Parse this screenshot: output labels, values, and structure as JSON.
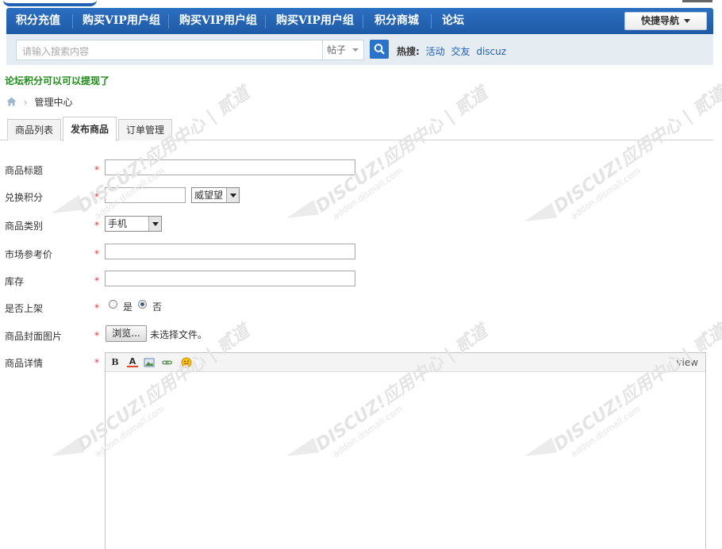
{
  "nav": {
    "items": [
      "积分充值",
      "购买VIP用户组",
      "购买VIP用户组",
      "购买VIP用户组",
      "积分商城",
      "论坛"
    ],
    "quick_nav_label": "快捷导航"
  },
  "search": {
    "placeholder": "请输入搜索内容",
    "type_label": "帖子",
    "hot_label": "热搜:",
    "hot_keywords": [
      "活动",
      "交友",
      "discuz"
    ]
  },
  "notice": "论坛积分可以可以提现了",
  "breadcrumb": {
    "current": "管理中心"
  },
  "tabs": [
    "商品列表",
    "发布商品",
    "订单管理"
  ],
  "form": {
    "title_label": "商品标题",
    "points_label": "兑换积分",
    "points_unit": "威望望",
    "category_label": "商品类别",
    "category_value": "手机",
    "market_price_label": "市场参考价",
    "stock_label": "库存",
    "on_shelf_label": "是否上架",
    "on_shelf_yes": "是",
    "on_shelf_no": "否",
    "cover_label": "商品封面图片",
    "browse_label": "浏览...",
    "no_file_label": "未选择文件。",
    "details_label": "商品详情",
    "required_mark": "*",
    "editor_view_label": "view"
  },
  "watermark": {
    "brand": "DISCUZ!应用中心 | 贰道",
    "url": "addon.dismall.com"
  },
  "colors": {
    "nav": "#2c6fc1",
    "notice": "#1f8a1a",
    "required": "#e33333",
    "link": "#1f5fb4"
  }
}
